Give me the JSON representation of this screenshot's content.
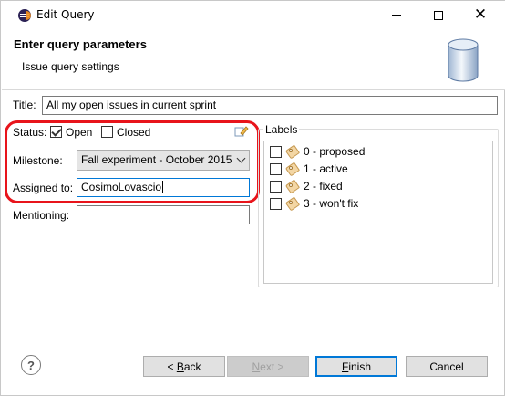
{
  "window": {
    "title": "Edit Query"
  },
  "header": {
    "title": "Enter query parameters",
    "subtitle": "Issue query settings"
  },
  "form": {
    "title_label": "Title:",
    "title_value": "All my open issues in current sprint",
    "status_label": "Status:",
    "status_options": [
      {
        "label": "Open",
        "checked": true
      },
      {
        "label": "Closed",
        "checked": false
      }
    ],
    "milestone_label": "Milestone:",
    "milestone_value": "Fall experiment - October 2015",
    "assigned_label": "Assigned to:",
    "assigned_value": "CosimoLovascio",
    "mentioning_label": "Mentioning:",
    "mentioning_value": ""
  },
  "labels_group": {
    "title": "Labels",
    "items": [
      {
        "label": "0 - proposed",
        "checked": false
      },
      {
        "label": "1 - active",
        "checked": false
      },
      {
        "label": "2 - fixed",
        "checked": false
      },
      {
        "label": "3 - won't fix",
        "checked": false
      }
    ]
  },
  "footer": {
    "help_glyph": "?",
    "back_accel": "B",
    "back_rest": "ack",
    "back_prefix": "< ",
    "next_accel": "N",
    "next_rest": "ext >",
    "finish_accel": "F",
    "finish_rest": "inish",
    "cancel_label": "Cancel"
  },
  "colors": {
    "highlight": "#e8141b",
    "focus_border": "#0078d7"
  },
  "icons": [
    "app-icon",
    "minimize-icon",
    "maximize-icon",
    "close-icon",
    "database-icon",
    "edit-pencil-icon",
    "dropdown-chevron-icon",
    "tag-icon",
    "help-icon"
  ]
}
